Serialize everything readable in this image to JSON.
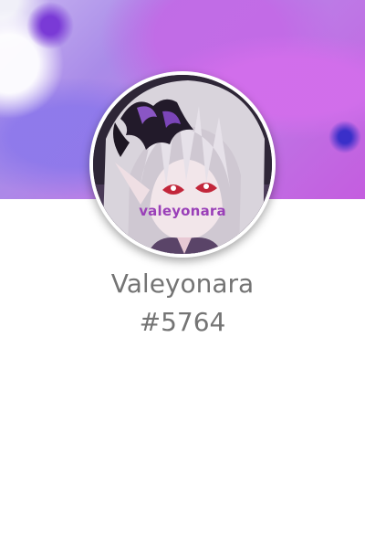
{
  "profile": {
    "username": "Valeyonara",
    "discriminator": "#5764",
    "avatar_watermark": "valeyonara"
  },
  "colors": {
    "banner_accent": "#b97ae6",
    "text": "#747474",
    "watermark": "#9a40b8"
  }
}
